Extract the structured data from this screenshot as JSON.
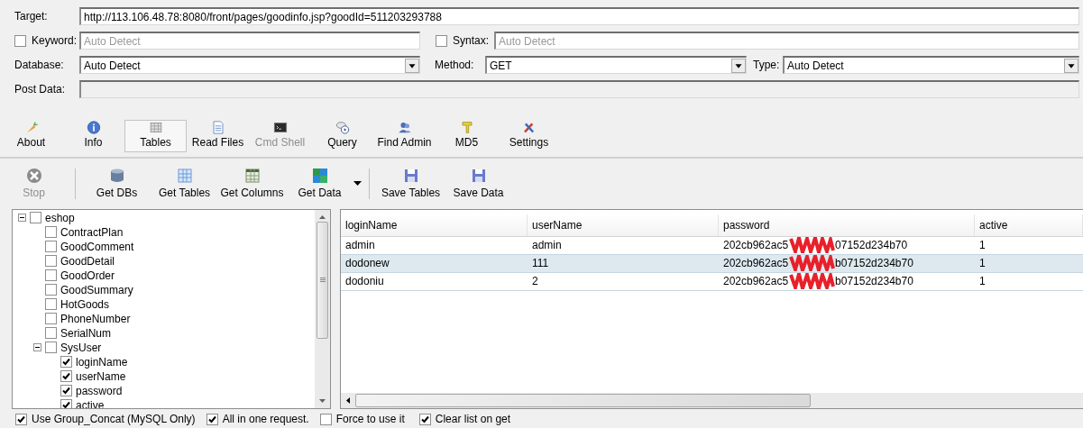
{
  "target": {
    "label": "Target:",
    "value": "http://113.106.48.78:8080/front/pages/goodinfo.jsp?goodId=511203293788"
  },
  "keyword": {
    "label": "Keyword:",
    "checked": false,
    "placeholder": "Auto Detect"
  },
  "syntax": {
    "label": "Syntax:",
    "checked": false,
    "placeholder": "Auto Detect"
  },
  "database": {
    "label": "Database:",
    "value": "Auto Detect"
  },
  "method": {
    "label": "Method:",
    "value": "GET"
  },
  "type": {
    "label": "Type:",
    "value": "Auto Detect"
  },
  "post_data": {
    "label": "Post Data:",
    "disabled": true
  },
  "main_tabs": [
    {
      "label": "About",
      "selected": false,
      "disabled": false
    },
    {
      "label": "Info",
      "selected": false,
      "disabled": false
    },
    {
      "label": "Tables",
      "selected": true,
      "disabled": false
    },
    {
      "label": "Read Files",
      "selected": false,
      "disabled": false
    },
    {
      "label": "Cmd Shell",
      "selected": false,
      "disabled": true
    },
    {
      "label": "Query",
      "selected": false,
      "disabled": false
    },
    {
      "label": "Find Admin",
      "selected": false,
      "disabled": false
    },
    {
      "label": "MD5",
      "selected": false,
      "disabled": false
    },
    {
      "label": "Settings",
      "selected": false,
      "disabled": false
    }
  ],
  "action_groups": [
    [
      {
        "label": "Stop",
        "disabled": true
      }
    ],
    [
      {
        "label": "Get DBs",
        "disabled": false
      },
      {
        "label": "Get Tables",
        "disabled": false
      },
      {
        "label": "Get Columns",
        "disabled": false
      },
      {
        "label": "Get Data",
        "disabled": false,
        "dropdown": true
      }
    ],
    [
      {
        "label": "Save Tables",
        "disabled": false
      },
      {
        "label": "Save Data",
        "disabled": false
      }
    ]
  ],
  "tree": [
    {
      "label": "eshop",
      "checked": false,
      "expanded": true,
      "children": [
        {
          "label": "ContractPlan",
          "checked": false
        },
        {
          "label": "GoodComment",
          "checked": false
        },
        {
          "label": "GoodDetail",
          "checked": false
        },
        {
          "label": "GoodOrder",
          "checked": false
        },
        {
          "label": "GoodSummary",
          "checked": false
        },
        {
          "label": "HotGoods",
          "checked": false
        },
        {
          "label": "PhoneNumber",
          "checked": false
        },
        {
          "label": "SerialNum",
          "checked": false
        },
        {
          "label": "SysUser",
          "checked": false,
          "expanded": true,
          "children": [
            {
              "label": "loginName",
              "checked": true
            },
            {
              "label": "userName",
              "checked": true
            },
            {
              "label": "password",
              "checked": true
            },
            {
              "label": "active",
              "checked": true
            }
          ]
        }
      ]
    }
  ],
  "options": [
    {
      "label": "Use Group_Concat (MySQL Only)",
      "checked": true
    },
    {
      "label": "All in one request.",
      "checked": true
    },
    {
      "label": "Force to use it",
      "checked": false
    }
  ],
  "clear_list": {
    "label": "Clear list on get",
    "checked": true
  },
  "table": {
    "columns": [
      "loginName",
      "userName",
      "password",
      "active"
    ],
    "rows": [
      {
        "selected": false,
        "login_name": "admin",
        "user_name": "admin",
        "password": {
          "start": "202cb962ac5",
          "end": "07152d234b70",
          "redacted": true
        },
        "active": "1"
      },
      {
        "selected": true,
        "login_name": "dodonew",
        "user_name": "111",
        "password": {
          "start": "202cb962ac5",
          "end": "b07152d234b70",
          "redacted": true
        },
        "active": "1"
      },
      {
        "selected": false,
        "login_name": "dodoniu",
        "user_name": "2",
        "password": {
          "start": "202cb962ac5",
          "end": "b07152d234b70",
          "redacted": true
        },
        "active": "1"
      }
    ]
  }
}
